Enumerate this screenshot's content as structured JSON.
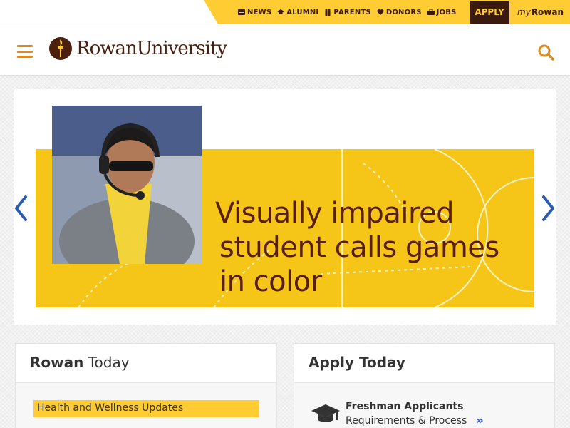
{
  "utility": {
    "links": [
      {
        "label": "NEWS",
        "icon": "newspaper-icon"
      },
      {
        "label": "ALUMNI",
        "icon": "graduation-cap-icon"
      },
      {
        "label": "PARENTS",
        "icon": "family-icon"
      },
      {
        "label": "DONORS",
        "icon": "heart-icon"
      },
      {
        "label": "JOBS",
        "icon": "briefcase-icon"
      }
    ],
    "apply_label": "APPLY",
    "my_prefix": "my",
    "my_suffix": "Rowan"
  },
  "header": {
    "logo_text_1": "Rowan",
    "logo_text_2": "University",
    "menu_icon": "hamburger-icon",
    "search_icon": "search-icon"
  },
  "carousel": {
    "headline_line1": "Visually impaired",
    "headline_line2": "student calls games",
    "headline_line3": "in color"
  },
  "rowan_today": {
    "title_bold": "Rowan",
    "title_rest": " Today",
    "items": [
      "Health and Wellness Updates"
    ]
  },
  "apply_today": {
    "title": "Apply Today",
    "items": [
      {
        "title": "Freshman Applicants",
        "subtitle": "Requirements & Process",
        "chevron": "»"
      }
    ]
  },
  "colors": {
    "gold": "#ffcc33",
    "brown": "#3a1a0c",
    "orange": "#e08a1e",
    "headline": "#5a1f0c"
  }
}
